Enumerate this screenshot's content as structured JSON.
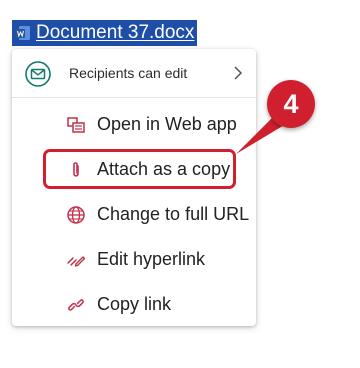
{
  "document_link": {
    "text": "Document 37.docx",
    "icon": "word-document-icon"
  },
  "menu": {
    "header": {
      "label": "Recipients can edit",
      "icon": "mail-icon",
      "chevron": "chevron-right-icon"
    },
    "items": [
      {
        "label": "Open in Web app",
        "icon": "open-web-app-icon"
      },
      {
        "label": "Attach as a copy",
        "icon": "paperclip-icon"
      },
      {
        "label": "Change to full URL",
        "icon": "globe-icon"
      },
      {
        "label": "Edit hyperlink",
        "icon": "edit-link-icon"
      },
      {
        "label": "Copy link",
        "icon": "link-icon"
      }
    ]
  },
  "callout": {
    "step": "4",
    "color": "#d0202f"
  },
  "colors": {
    "selection": "#1e4ea8",
    "accent_teal": "#0f7b6c",
    "icon_red": "#c4314b"
  }
}
